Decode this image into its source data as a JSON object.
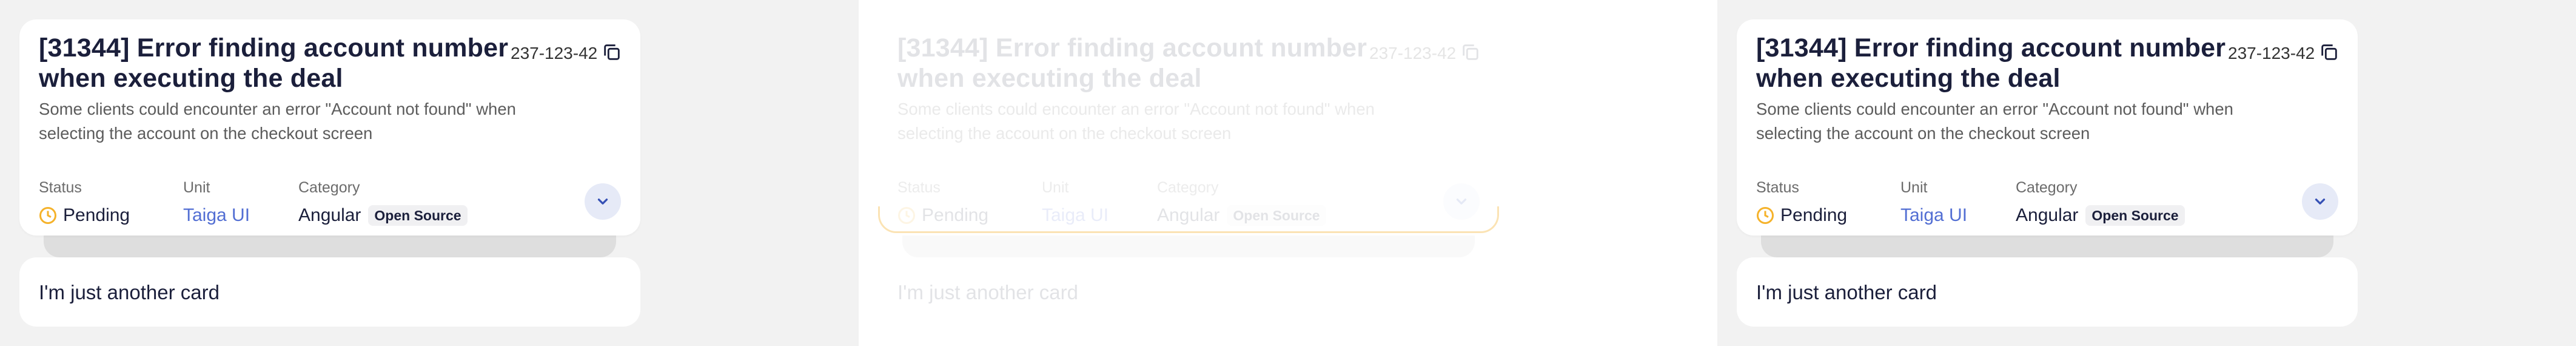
{
  "card": {
    "title": "[31344] Error finding account number when executing the deal",
    "number": "237-123-42",
    "description": "Some clients could encounter an error \"Account not found\" when selecting the account on the checkout screen",
    "status": {
      "label": "Status",
      "value": "Pending"
    },
    "unit": {
      "label": "Unit",
      "value": "Taiga UI"
    },
    "category": {
      "label": "Category",
      "value": "Angular",
      "badge": "Open Source"
    }
  },
  "second_card": {
    "text": "I'm just another card"
  },
  "colors": {
    "pending": "#f5b22a",
    "link": "#526ed3",
    "expand_bg": "#e6eaf7",
    "text": "#1b1f3b"
  },
  "icons": [
    "copy-icon",
    "clock-icon",
    "chevron-down-icon"
  ]
}
